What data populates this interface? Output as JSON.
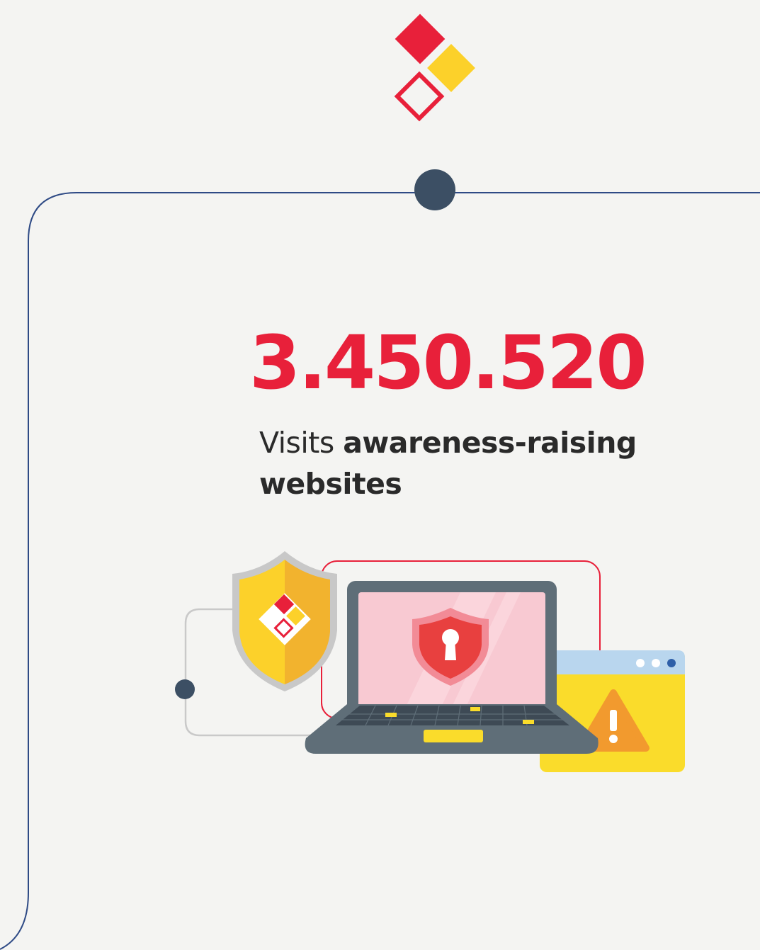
{
  "colors": {
    "background": "#f4f4f2",
    "brand_red": "#e8203a",
    "brand_yellow": "#fcd12a",
    "frame_line": "#2e4a85",
    "node_dark": "#3c4f64",
    "text_dark": "#2a2a2a",
    "laptop_body": "#5f6e78",
    "screen_pink": "#f8c9d2",
    "shield_gold": "#f2b32e"
  },
  "icons": {
    "logo": "brand-diamonds-icon",
    "shield": "security-shield-icon",
    "laptop": "laptop-lock-icon",
    "warning": "warning-triangle-icon",
    "browser": "browser-window-icon"
  },
  "stat": {
    "value": "3.450.520",
    "caption_light": "Visits ",
    "caption_strong": "awareness-raising websites"
  }
}
